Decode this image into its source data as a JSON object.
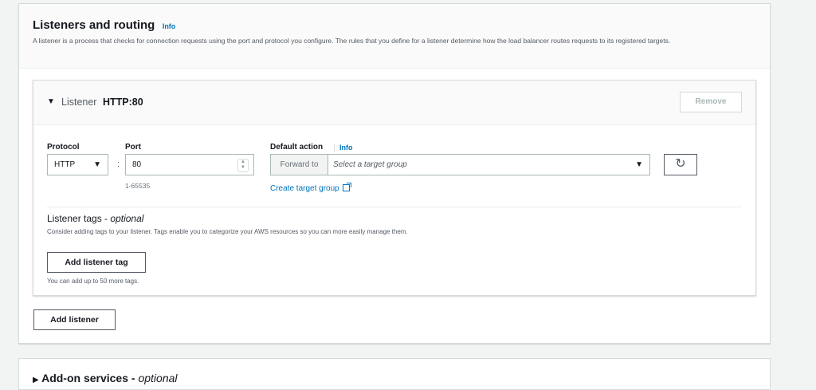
{
  "section": {
    "title": "Listeners and routing",
    "info": "Info",
    "description": "A listener is a process that checks for connection requests using the port and protocol you configure. The rules that you define for a listener determine how the load balancer routes requests to its registered targets."
  },
  "listener": {
    "caret": "▼",
    "prefix": "Listener",
    "name": "HTTP:80",
    "remove_label": "Remove",
    "protocol_label": "Protocol",
    "protocol_value": "HTTP",
    "port_label": "Port",
    "port_value": "80",
    "port_hint": "1-65535",
    "default_action_label": "Default action",
    "default_action_info": "Info",
    "forward_to": "Forward to",
    "target_group_placeholder": "Select a target group",
    "create_target_group": "Create target group",
    "refresh_icon": "↻",
    "tags": {
      "title": "Listener tags",
      "title_optional": "optional",
      "description": "Consider adding tags to your listener. Tags enable you to categorize your AWS resources so you can more easily manage them.",
      "add_button": "Add listener tag",
      "hint": "You can add up to 50 more tags."
    }
  },
  "add_listener_label": "Add listener",
  "addon": {
    "caret": "▶",
    "title": "Add-on services",
    "optional": "optional"
  },
  "colors": {
    "link": "#0073bb",
    "background": "#f2f3f3",
    "text": "#16191f"
  }
}
